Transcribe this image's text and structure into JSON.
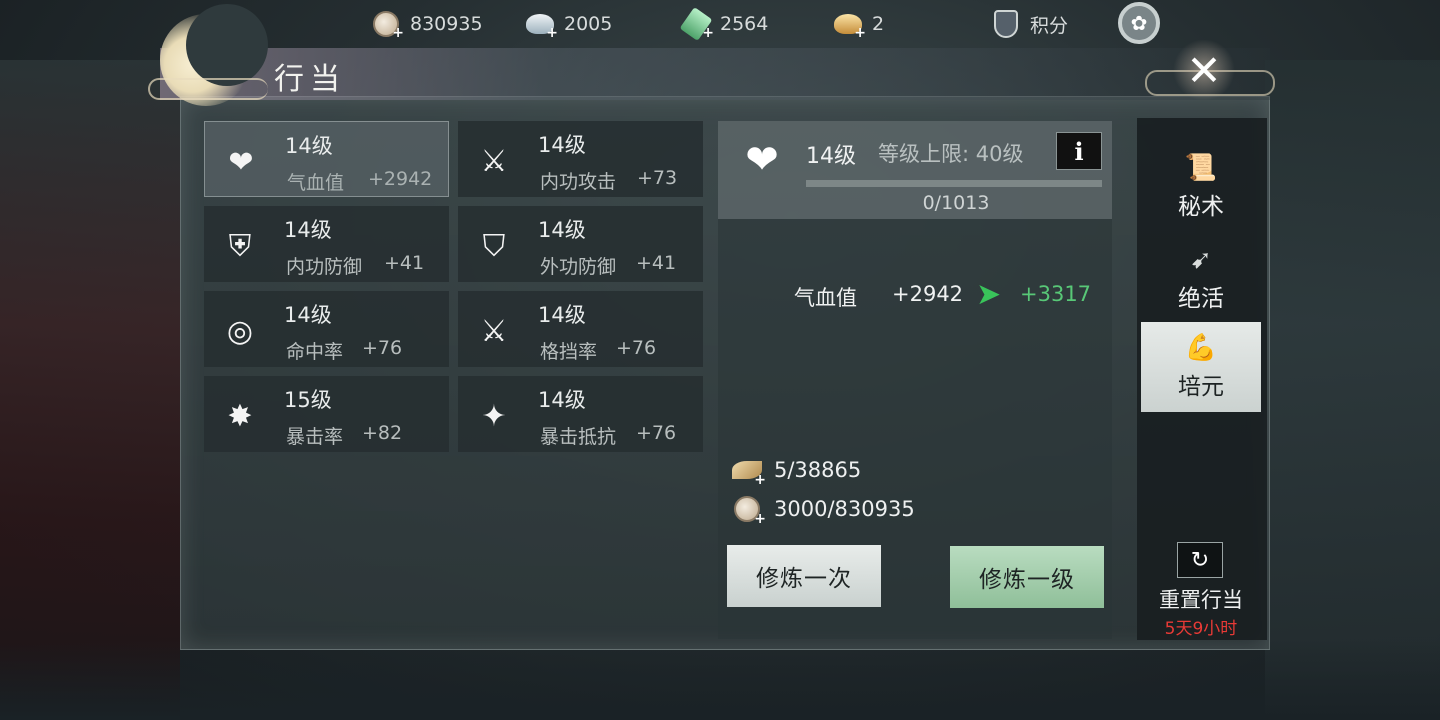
{
  "resources": [
    {
      "icon": "copper-coin-icon",
      "value": "830935"
    },
    {
      "icon": "silver-ingot-icon",
      "value": "2005"
    },
    {
      "icon": "jade-icon",
      "value": "2564"
    },
    {
      "icon": "gold-ingot-icon",
      "value": "2"
    }
  ],
  "points": {
    "label": "积分"
  },
  "panel": {
    "title": "行当"
  },
  "stats": [
    {
      "level": "14级",
      "name": "气血值",
      "bonus": "+2942",
      "icon": "heart-lotus-icon",
      "selected": true
    },
    {
      "level": "14级",
      "name": "内功攻击",
      "bonus": "+73",
      "icon": "inner-attack-icon"
    },
    {
      "level": "14级",
      "name": "内功防御",
      "bonus": "+41",
      "icon": "inner-defense-icon"
    },
    {
      "level": "14级",
      "name": "外功防御",
      "bonus": "+41",
      "icon": "outer-defense-icon"
    },
    {
      "level": "14级",
      "name": "命中率",
      "bonus": "+76",
      "icon": "target-icon"
    },
    {
      "level": "14级",
      "name": "格挡率",
      "bonus": "+76",
      "icon": "crossed-swords-icon"
    },
    {
      "level": "15级",
      "name": "暴击率",
      "bonus": "+82",
      "icon": "burst-icon"
    },
    {
      "level": "14级",
      "name": "暴击抵抗",
      "bonus": "+76",
      "icon": "crit-resist-icon"
    }
  ],
  "detail": {
    "level": "14级",
    "cap": "等级上限: 40级",
    "info": "i",
    "progress_text": "0/1013",
    "progress_fraction": 0,
    "attr_name": "气血值",
    "attr_current": "+2942",
    "attr_next": "+3317",
    "cost_items": "5/38865",
    "cost_coins": "3000/830935",
    "btn_once": "修炼一次",
    "btn_level": "修炼一级"
  },
  "sidebar": {
    "tabs": [
      {
        "label": "秘术",
        "icon": "scroll-icon"
      },
      {
        "label": "绝活",
        "icon": "bow-icon"
      },
      {
        "label": "培元",
        "icon": "muscle-icon",
        "active": true
      }
    ],
    "reset_label": "重置行当",
    "reset_time": "5天9小时"
  },
  "colors": {
    "accent_green": "#58c877",
    "timer_red": "#e83a36"
  }
}
